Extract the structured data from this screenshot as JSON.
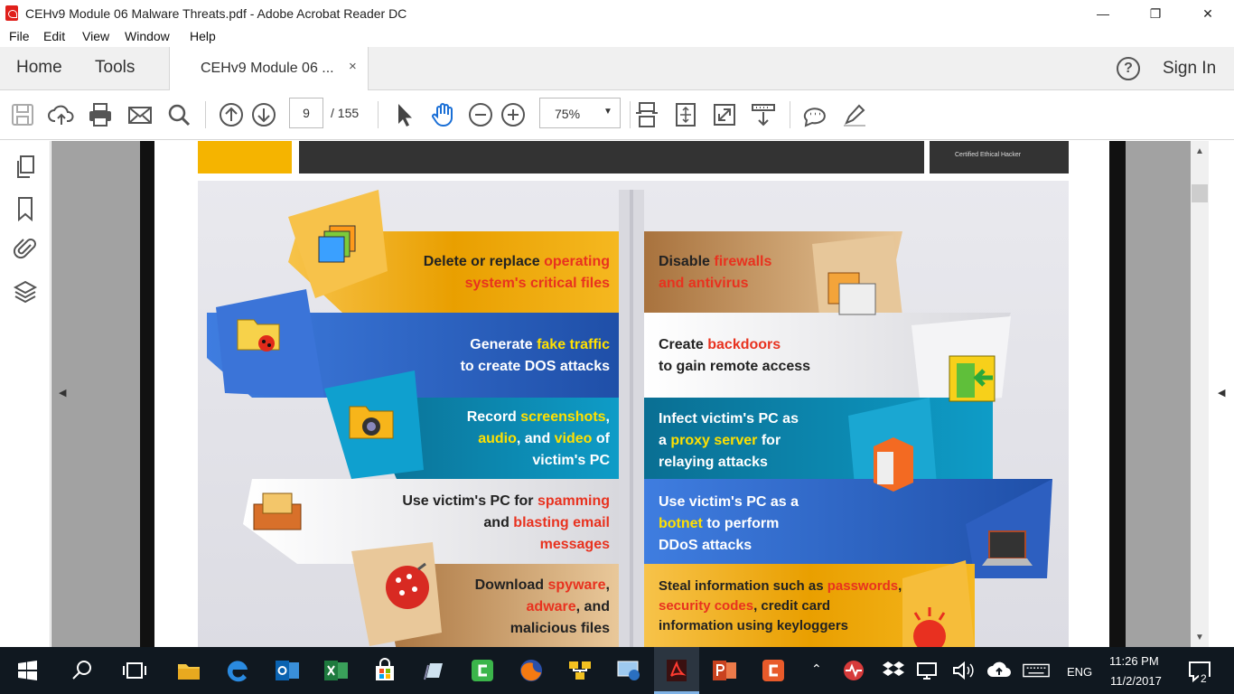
{
  "window": {
    "title": "CEHv9 Module 06 Malware Threats.pdf - Adobe Acrobat Reader DC",
    "minimize": "—",
    "restore": "❐",
    "close": "✕"
  },
  "menu": [
    "File",
    "Edit",
    "View",
    "Window",
    "Help"
  ],
  "tabs": {
    "home": "Home",
    "tools": "Tools",
    "document": "CEHv9 Module 06 ...",
    "close": "×",
    "help": "?",
    "sign_in": "Sign In"
  },
  "toolbar": {
    "page_current": "9",
    "page_total": "/ 155",
    "zoom": "75%",
    "zoom_caret": "▼"
  },
  "nav": {
    "left_arrow": "◀",
    "right_arrow": "◀",
    "scroll_up": "▲",
    "scroll_down": "▼"
  },
  "slide": {
    "header_logo_text": "Certified   Ethical   Hacker",
    "left": [
      {
        "parts": [
          [
            "Delete or replace ",
            "n"
          ],
          [
            "operating",
            "r"
          ]
        ],
        "line2": [
          [
            "system's critical files",
            "r"
          ]
        ]
      },
      {
        "parts": [
          [
            "Generate ",
            "w"
          ],
          [
            "fake traffic",
            "y"
          ]
        ],
        "line2": [
          [
            "to create DOS attacks",
            "w"
          ]
        ]
      },
      {
        "parts": [
          [
            "Record ",
            "w"
          ],
          [
            "screenshots",
            "y"
          ],
          [
            ",",
            "w"
          ]
        ],
        "line2": [
          [
            "audio",
            "y"
          ],
          [
            ", and ",
            "w"
          ],
          [
            "video",
            "y"
          ],
          [
            " of",
            "w"
          ]
        ],
        "line3": [
          [
            "victim's PC",
            "w"
          ]
        ]
      },
      {
        "parts": [
          [
            "Use victim's PC for ",
            "n"
          ],
          [
            "spamming",
            "r"
          ]
        ],
        "line2": [
          [
            "and ",
            "n"
          ],
          [
            "blasting email",
            "r"
          ]
        ],
        "line3": [
          [
            "messages",
            "r"
          ]
        ]
      },
      {
        "parts": [
          [
            "Download ",
            "n"
          ],
          [
            "spyware",
            "r"
          ],
          [
            ",",
            "n"
          ]
        ],
        "line2": [
          [
            "adware",
            "r"
          ],
          [
            ", and",
            "n"
          ]
        ],
        "line3": [
          [
            "malicious files",
            "n"
          ]
        ]
      }
    ],
    "right": [
      {
        "parts": [
          [
            "Disable ",
            "n"
          ],
          [
            "firewalls",
            "r"
          ]
        ],
        "line2": [
          [
            "and antivirus",
            "r"
          ]
        ]
      },
      {
        "parts": [
          [
            "Create ",
            "n"
          ],
          [
            "backdoors",
            "r"
          ]
        ],
        "line2": [
          [
            "to gain remote access",
            "n"
          ]
        ]
      },
      {
        "parts": [
          [
            "Infect victim's PC as",
            "w"
          ]
        ],
        "line2": [
          [
            "a ",
            "w"
          ],
          [
            "proxy server",
            "y"
          ],
          [
            " for",
            "w"
          ]
        ],
        "line3": [
          [
            "relaying attacks",
            "w"
          ]
        ]
      },
      {
        "parts": [
          [
            "Use victim's PC as a",
            "w"
          ]
        ],
        "line2": [
          [
            "botnet",
            "y"
          ],
          [
            " to perform",
            "w"
          ]
        ],
        "line3": [
          [
            "DDoS attacks",
            "w"
          ]
        ]
      },
      {
        "parts": [
          [
            "Steal information such as ",
            "n"
          ],
          [
            "passwords",
            "r"
          ],
          [
            ",",
            "n"
          ]
        ],
        "line2": [
          [
            "security codes",
            "r"
          ],
          [
            ", credit card",
            "n"
          ]
        ],
        "line3": [
          [
            "information using keyloggers",
            "n"
          ]
        ]
      }
    ]
  },
  "taskbar": {
    "language": "ENG",
    "time": "11:26 PM",
    "date": "11/2/2017",
    "notifications": "2"
  },
  "colors": {
    "orange": "#f0a800",
    "blue": "#2d64c2",
    "teal": "#0e8ab0",
    "red_highlight": "#e8321f",
    "yellow_highlight": "#ffe000",
    "taskbar": "#101820"
  }
}
